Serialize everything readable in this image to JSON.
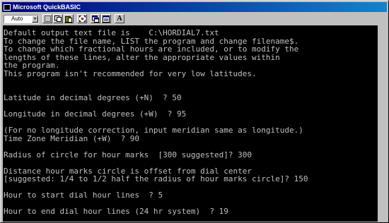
{
  "window": {
    "title": "Microsoft QuickBASIC"
  },
  "toolbar": {
    "font_size_value": "Auto",
    "buttons": [
      {
        "name": "mark-icon"
      },
      {
        "name": "copy-icon"
      },
      {
        "name": "paste-icon"
      },
      {
        "name": "fullscreen-icon"
      },
      {
        "name": "properties-icon"
      },
      {
        "name": "background-icon"
      },
      {
        "name": "font-icon",
        "glyph": "A"
      }
    ]
  },
  "console": {
    "lines": [
      "Default output text file is    C:\\HORDIAL7.txt",
      "To change the file name, LIST the program and change filename$.",
      "To change which fractional hours are included, or to modify the",
      "lengths of these lines, alter the appropriate values within",
      "the program.",
      "This program isn't recommended for very low latitudes.",
      "",
      "",
      "Latitude in decimal degrees (+N)  ? 50",
      "",
      "Longitude in decimal degrees (+W)  ? 95",
      "",
      "(For no longitude correction, input meridian same as longitude.)",
      "Time Zone Meridian (+W)  ? 90",
      "",
      "Radius of circle for hour marks  [300 suggested]? 300",
      "",
      "Distance hour marks circle is offset from dial center",
      "[suggested: 1/4 to 1/2 half the radius of hour marks circle]? 150",
      "",
      "Hour to start dial hour lines  ? 5",
      "",
      "Hour to end dial hour lines (24 hr system)  ? 19"
    ]
  },
  "colors": {
    "titlebar": "#000080",
    "console_bg": "#000000",
    "console_text": "#c0c0c0"
  }
}
